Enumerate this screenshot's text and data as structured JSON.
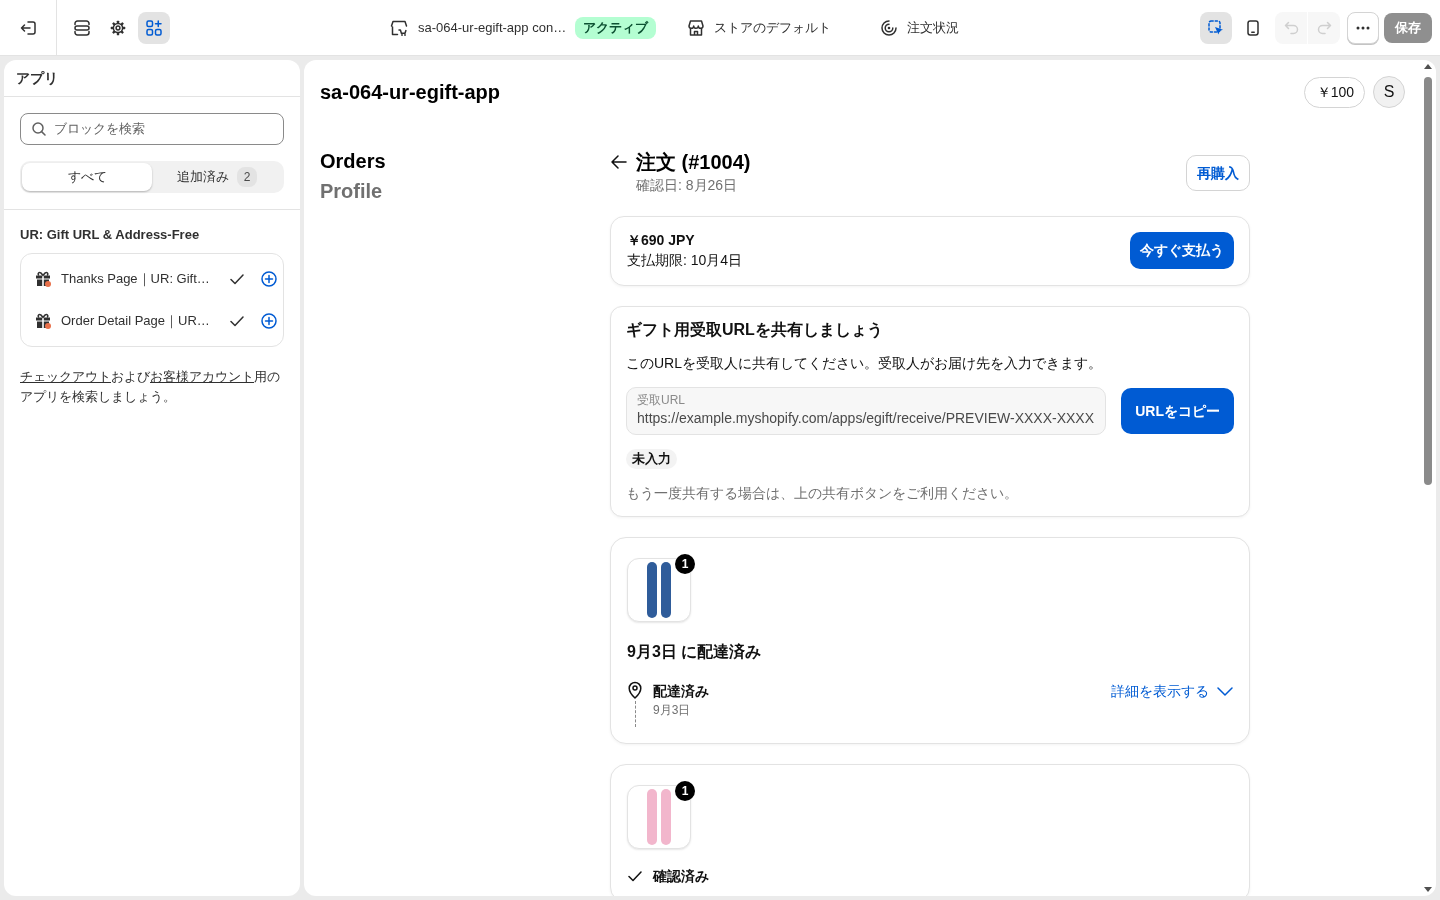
{
  "toolbar": {
    "tools": [
      {
        "kind": "sections",
        "selected": false
      },
      {
        "kind": "settings",
        "selected": false
      },
      {
        "kind": "apps",
        "selected": true
      }
    ],
    "store": {
      "name": "sa-064-ur-egift-app con…",
      "status": "アクティブ"
    },
    "theme": "ストアのデフォルト",
    "page": "注文状況",
    "view_tools": [
      {
        "kind": "inspector",
        "selected": true
      },
      {
        "kind": "mobile",
        "selected": false
      }
    ],
    "history": [
      {
        "kind": "undo",
        "disabled": true
      },
      {
        "kind": "redo",
        "disabled": true
      }
    ],
    "save": {
      "label": "保存",
      "disabled": true
    }
  },
  "sidebar": {
    "title": "アプリ",
    "search": {
      "placeholder": "ブロックを検索"
    },
    "tabs": [
      {
        "label": "すべて",
        "selected": true
      },
      {
        "label": "追加済み",
        "count": "2",
        "selected": false
      }
    ],
    "section_title": "UR: Gift URL & Address-Free",
    "blocks": [
      {
        "label": "Thanks Page｜UR: Gift…",
        "added": true
      },
      {
        "label": "Order Detail Page｜UR…",
        "added": true
      }
    ],
    "help_text": [
      {
        "kind": "link",
        "text": "チェックアウト"
      },
      {
        "kind": "text",
        "text": "および"
      },
      {
        "kind": "link",
        "text": "お客様アカウント"
      },
      {
        "kind": "text",
        "text": "用のアプリを検索しましょう。"
      }
    ]
  },
  "preview": {
    "shop_name": "sa-064-ur-egift-app",
    "credit": "￥100",
    "avatar": "S",
    "nav": [
      {
        "label": "Orders",
        "selected": true
      },
      {
        "label": "Profile",
        "selected": false
      }
    ],
    "order": {
      "title": "注文 (#1004)",
      "confirmed": "確認日: 8月26日",
      "reorder": "再購入",
      "payment": {
        "amount": "￥690 JPY",
        "due": "支払期限: 10月4日",
        "pay_button": "今すぐ支払う"
      },
      "gift": {
        "title": "ギフト用受取URLを共有しましょう",
        "description": "このURLを受取人に共有してください。受取人がお届け先を入力できます。",
        "url_field": {
          "label": "受取URL",
          "value": "https://example.myshopify.com/apps/egift/receive/PREVIEW-XXXX-XXXX"
        },
        "copy_button": "URLをコピー",
        "status": "未入力",
        "note": "もう一度共有する場合は、上の共有ボタンをご利用ください。"
      },
      "fulfillments": [
        {
          "product": {
            "quantity": "1",
            "color": "#2f5c9a"
          },
          "heading": "9月3日 に配達済み",
          "event": {
            "kind": "pin",
            "title": "配達済み",
            "date": "9月3日"
          },
          "link": "詳細を表示する"
        },
        {
          "product": {
            "quantity": "1",
            "color": "#f2b6cc"
          },
          "event": {
            "kind": "check",
            "title": "確認済み"
          }
        }
      ]
    }
  }
}
